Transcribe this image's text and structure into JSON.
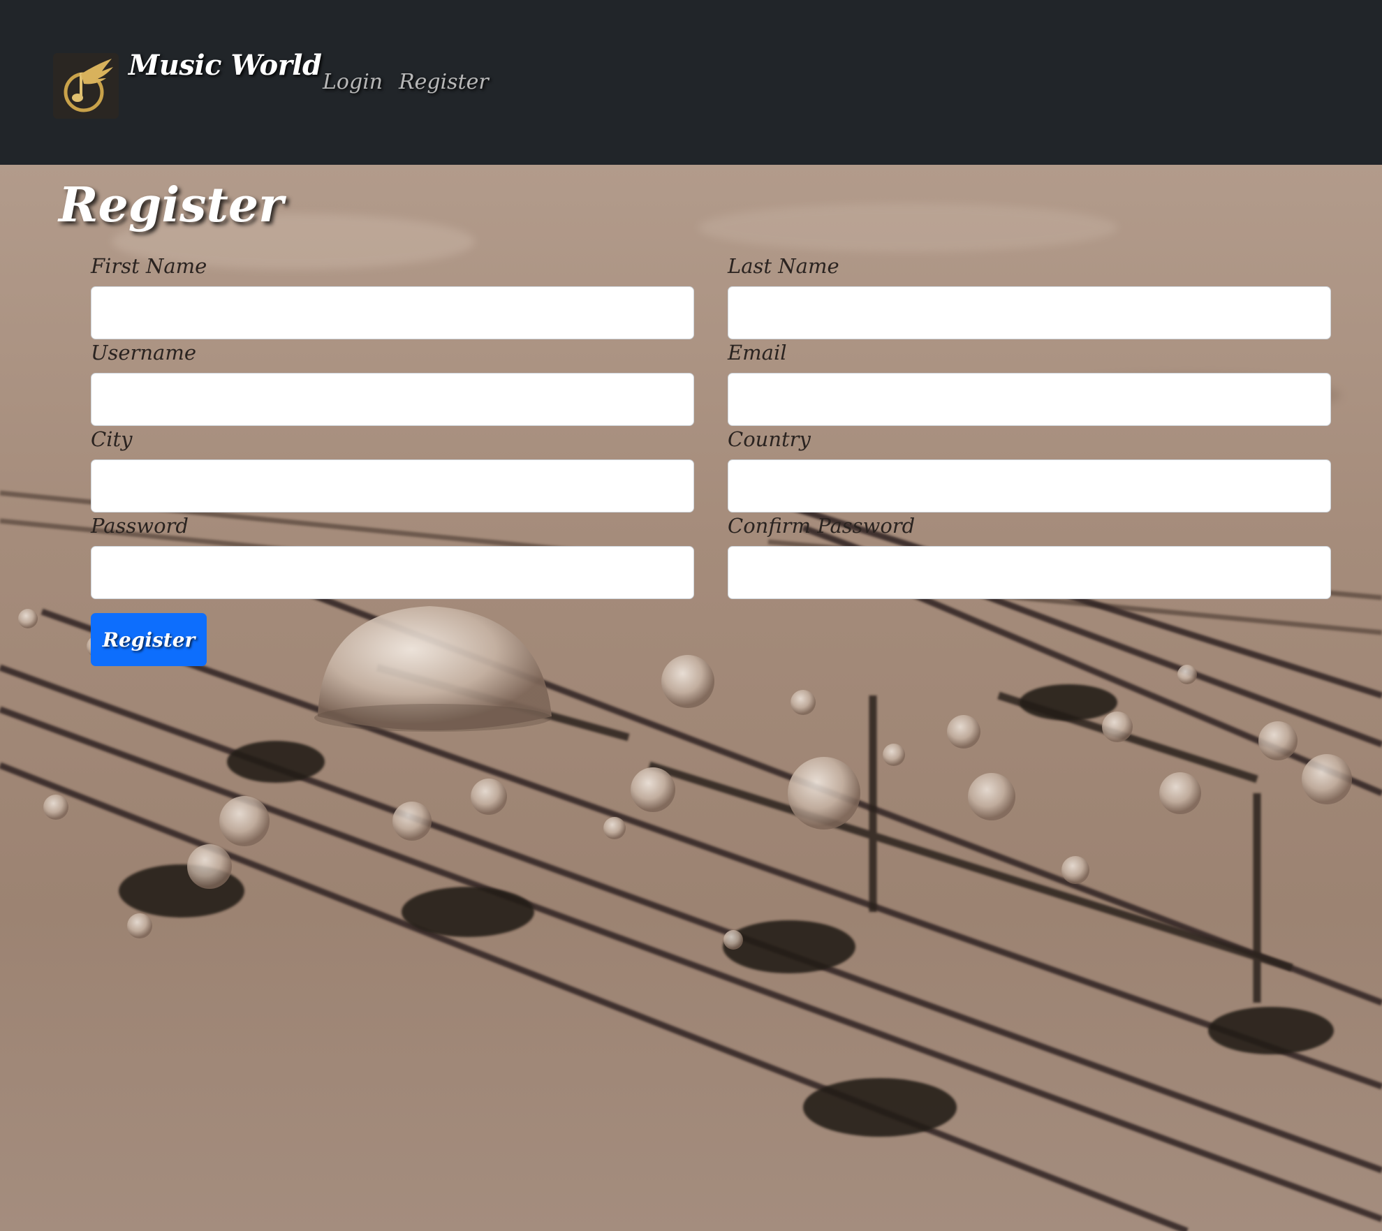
{
  "navbar": {
    "brand": "Music World",
    "links": {
      "login": "Login",
      "register": "Register"
    },
    "logo_icon": "music-note-wing-icon"
  },
  "form": {
    "title": "Register",
    "fields": {
      "first_name": {
        "label": "First Name",
        "value": ""
      },
      "last_name": {
        "label": "Last Name",
        "value": ""
      },
      "username": {
        "label": "Username",
        "value": ""
      },
      "email": {
        "label": "Email",
        "value": ""
      },
      "city": {
        "label": "City",
        "value": ""
      },
      "country": {
        "label": "Country",
        "value": ""
      },
      "password": {
        "label": "Password",
        "value": ""
      },
      "confirm_password": {
        "label": "Confirm Password",
        "value": ""
      }
    },
    "submit_label": "Register"
  },
  "colors": {
    "navbar_bg": "#212529",
    "primary_button": "#0d6efd",
    "background_tone": "#ad9584"
  }
}
